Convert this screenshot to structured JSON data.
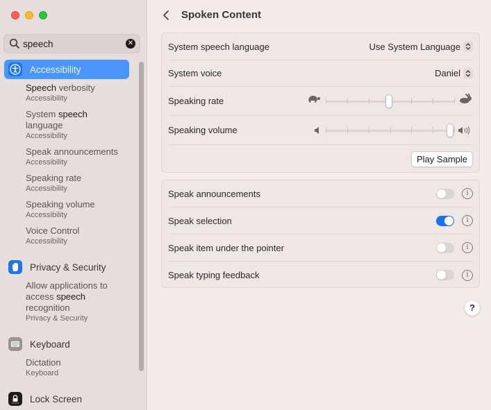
{
  "window": {
    "controls": [
      "close",
      "minimize",
      "maximize"
    ]
  },
  "sidebar": {
    "search": {
      "value": "speech",
      "placeholder": "Search",
      "icon": "search-icon",
      "clear_icon": "clear-icon"
    },
    "categories": [
      {
        "label": "Accessibility",
        "icon": "accessibility-icon",
        "icon_color": "#1f75f0",
        "selected": true,
        "results": [
          {
            "prefix": "",
            "highlight": "Speech",
            "suffix": " verbosity",
            "sub": "Accessibility"
          },
          {
            "prefix": "System ",
            "highlight": "speech",
            "suffix": " language",
            "sub": "Accessibility"
          },
          {
            "prefix": "Speak announcements",
            "highlight": "",
            "suffix": "",
            "sub": "Accessibility"
          },
          {
            "prefix": "Speaking rate",
            "highlight": "",
            "suffix": "",
            "sub": "Accessibility"
          },
          {
            "prefix": "Speaking volume",
            "highlight": "",
            "suffix": "",
            "sub": "Accessibility"
          },
          {
            "prefix": "Voice Control",
            "highlight": "",
            "suffix": "",
            "sub": "Accessibility"
          }
        ]
      },
      {
        "label": "Privacy & Security",
        "icon": "hand-icon",
        "icon_color": "#1f75f0",
        "selected": false,
        "results": [
          {
            "prefix": "Allow applications to access ",
            "highlight": "speech",
            "suffix": " recognition",
            "sub": "Privacy & Security"
          }
        ]
      },
      {
        "label": "Keyboard",
        "icon": "keyboard-icon",
        "icon_color": "#8e8887",
        "selected": false,
        "results": [
          {
            "prefix": "Dictation",
            "highlight": "",
            "suffix": "",
            "sub": "Keyboard"
          }
        ]
      },
      {
        "label": "Lock Screen",
        "icon": "lock-icon",
        "icon_color": "#1f1b1a",
        "selected": false,
        "results": []
      }
    ]
  },
  "main": {
    "title": "Spoken Content",
    "back_icon": "chevron-left-icon",
    "group1": {
      "system_speech_language": {
        "label": "System speech language",
        "value": "Use System Language"
      },
      "system_voice": {
        "label": "System voice",
        "value": "Daniel"
      },
      "speaking_rate": {
        "label": "Speaking rate",
        "value": 0.5,
        "ticks": 7,
        "min_icon": "turtle-icon",
        "max_icon": "rabbit-icon"
      },
      "speaking_volume": {
        "label": "Speaking volume",
        "value": 1.0,
        "ticks": 7,
        "min_icon": "speaker-low-icon",
        "max_icon": "speaker-high-icon"
      },
      "play_sample": "Play Sample"
    },
    "group2": [
      {
        "label": "Speak announcements",
        "on": false
      },
      {
        "label": "Speak selection",
        "on": true
      },
      {
        "label": "Speak item under the pointer",
        "on": false
      },
      {
        "label": "Speak typing feedback",
        "on": false
      }
    ],
    "help_label": "?",
    "accent_color": "#1a73f0"
  }
}
